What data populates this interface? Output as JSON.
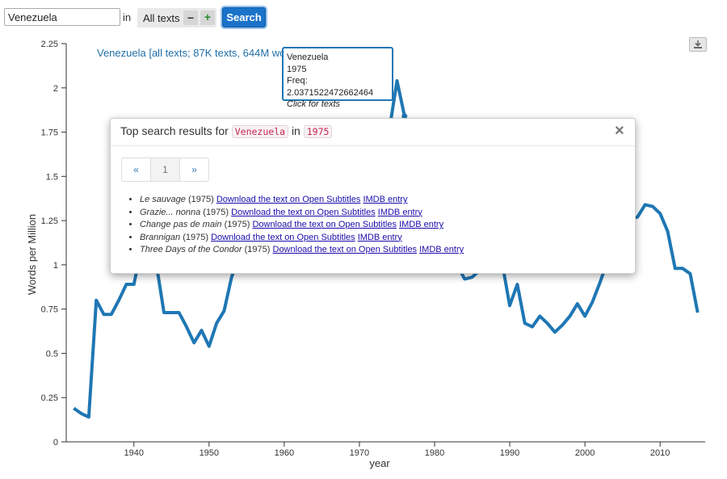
{
  "search": {
    "value": "Venezuela",
    "in_label": "in",
    "corpus": "All texts",
    "minus": "–",
    "plus": "+",
    "button": "Search"
  },
  "chart_data": {
    "type": "line",
    "title": "Venezuela [all texts; 87K texts, 644M words]",
    "xlabel": "year",
    "ylabel": "Words per Million",
    "xlim": [
      1931,
      2016
    ],
    "ylim": [
      0,
      2.25
    ],
    "xticks": [
      1940,
      1950,
      1960,
      1970,
      1980,
      1990,
      2000,
      2010
    ],
    "yticks": [
      "0",
      "0.25",
      "0.5",
      "0.75",
      "1",
      "1.25",
      "1.5",
      "1.75",
      "2",
      "2.25"
    ],
    "grid": false,
    "series": [
      {
        "name": "Venezuela",
        "color": "#1f77b4",
        "x": [
          1932,
          1933,
          1934,
          1935,
          1936,
          1937,
          1938,
          1939,
          1940,
          1941,
          1942,
          1943,
          1944,
          1945,
          1946,
          1947,
          1948,
          1949,
          1950,
          1951,
          1952,
          1953,
          1954,
          1955,
          1956,
          1957,
          1958,
          1959,
          1960,
          1961,
          1962,
          1963,
          1964,
          1965,
          1966,
          1967,
          1968,
          1969,
          1970,
          1971,
          1972,
          1973,
          1974,
          1975,
          1976,
          1977,
          1978,
          1979,
          1980,
          1981,
          1982,
          1983,
          1984,
          1985,
          1986,
          1987,
          1988,
          1989,
          1990,
          1991,
          1992,
          1993,
          1994,
          1995,
          1996,
          1997,
          1998,
          1999,
          2000,
          2001,
          2002,
          2003,
          2004,
          2005,
          2006,
          2007,
          2008,
          2009,
          2010,
          2011,
          2012,
          2013,
          2014,
          2015
        ],
        "values": [
          0.19,
          0.16,
          0.14,
          0.8,
          0.72,
          0.72,
          0.8,
          0.89,
          0.89,
          1.1,
          1.25,
          1.0,
          0.73,
          0.73,
          0.73,
          0.65,
          0.56,
          0.63,
          0.54,
          0.67,
          0.74,
          0.93,
          1.05,
          1.1,
          1.12,
          1.1,
          1.12,
          1.15,
          1.18,
          1.2,
          1.2,
          1.18,
          1.15,
          1.12,
          1.1,
          1.12,
          1.15,
          1.2,
          1.3,
          1.4,
          1.5,
          1.62,
          1.77,
          2.04,
          1.84,
          1.55,
          1.4,
          1.3,
          1.2,
          1.1,
          1.05,
          1.0,
          0.92,
          0.93,
          0.97,
          1.0,
          1.0,
          1.01,
          0.77,
          0.89,
          0.67,
          0.65,
          0.71,
          0.67,
          0.62,
          0.66,
          0.71,
          0.78,
          0.71,
          0.79,
          0.9,
          1.02,
          1.15,
          1.22,
          1.26,
          1.27,
          1.34,
          1.33,
          1.29,
          1.19,
          0.98,
          0.98,
          0.95,
          0.73
        ]
      }
    ]
  },
  "tooltip": {
    "name": "Venezuela",
    "year": "1975",
    "freq": "Freq: 2.0371522472662464",
    "hint": "Click for texts"
  },
  "modal": {
    "title": "Top search results for",
    "term": "Venezuela",
    "in": "in",
    "year": "1975",
    "close": "×",
    "pager": {
      "prev": "«",
      "page": "1",
      "next": "»"
    },
    "results": [
      {
        "title": "Le sauvage",
        "year": "(1975)",
        "download": "Download the text on Open Subtitles",
        "imdb": "IMDB entry"
      },
      {
        "title": "Grazie... nonna",
        "year": "(1975)",
        "download": "Download the text on Open Subtitles",
        "imdb": "IMDB entry"
      },
      {
        "title": "Change pas de main",
        "year": "(1975)",
        "download": "Download the text on Open Subtitles",
        "imdb": "IMDB entry"
      },
      {
        "title": "Brannigan",
        "year": "(1975)",
        "download": "Download the text on Open Subtitles",
        "imdb": "IMDB entry"
      },
      {
        "title": "Three Days of the Condor",
        "year": "(1975)",
        "download": "Download the text on Open Subtitles",
        "imdb": "IMDB entry"
      }
    ]
  },
  "icons": {
    "download": "download-icon",
    "close": "close-icon"
  }
}
